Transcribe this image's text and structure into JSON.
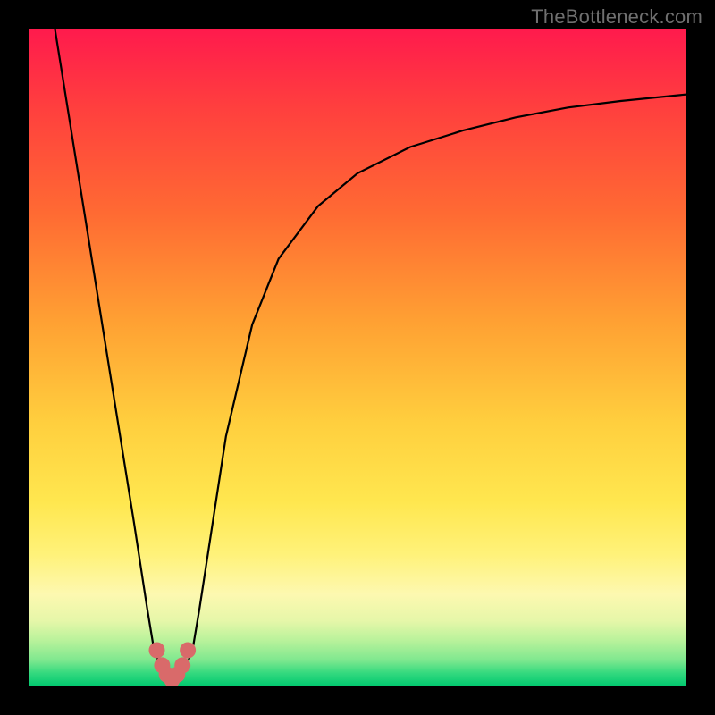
{
  "watermark": "TheBottleneck.com",
  "chart_data": {
    "type": "line",
    "title": "",
    "xlabel": "",
    "ylabel": "",
    "xlim": [
      0,
      100
    ],
    "ylim": [
      0,
      100
    ],
    "series": [
      {
        "name": "curve",
        "x": [
          4,
          8,
          12,
          16,
          18,
          19,
          20,
          21,
          22,
          23,
          24,
          25,
          26,
          28,
          30,
          34,
          38,
          44,
          50,
          58,
          66,
          74,
          82,
          90,
          100
        ],
        "y": [
          100,
          75,
          50,
          25,
          12,
          6,
          3,
          1.5,
          1,
          1.5,
          3,
          6,
          12,
          25,
          38,
          55,
          65,
          73,
          78,
          82,
          84.5,
          86.5,
          88,
          89,
          90
        ]
      }
    ],
    "valley_marker": {
      "name": "valley",
      "color": "#d96a6a",
      "x": [
        19.5,
        20.3,
        21,
        21.8,
        22.6,
        23.4,
        24.2
      ],
      "y": [
        5.5,
        3.2,
        1.8,
        1.0,
        1.8,
        3.2,
        5.5
      ]
    },
    "gradient_stops": [
      {
        "pos": 0,
        "color": "#ff1a4d"
      },
      {
        "pos": 50,
        "color": "#ffcf3e"
      },
      {
        "pos": 88,
        "color": "#fdf8b0"
      },
      {
        "pos": 100,
        "color": "#00c86f"
      }
    ]
  }
}
